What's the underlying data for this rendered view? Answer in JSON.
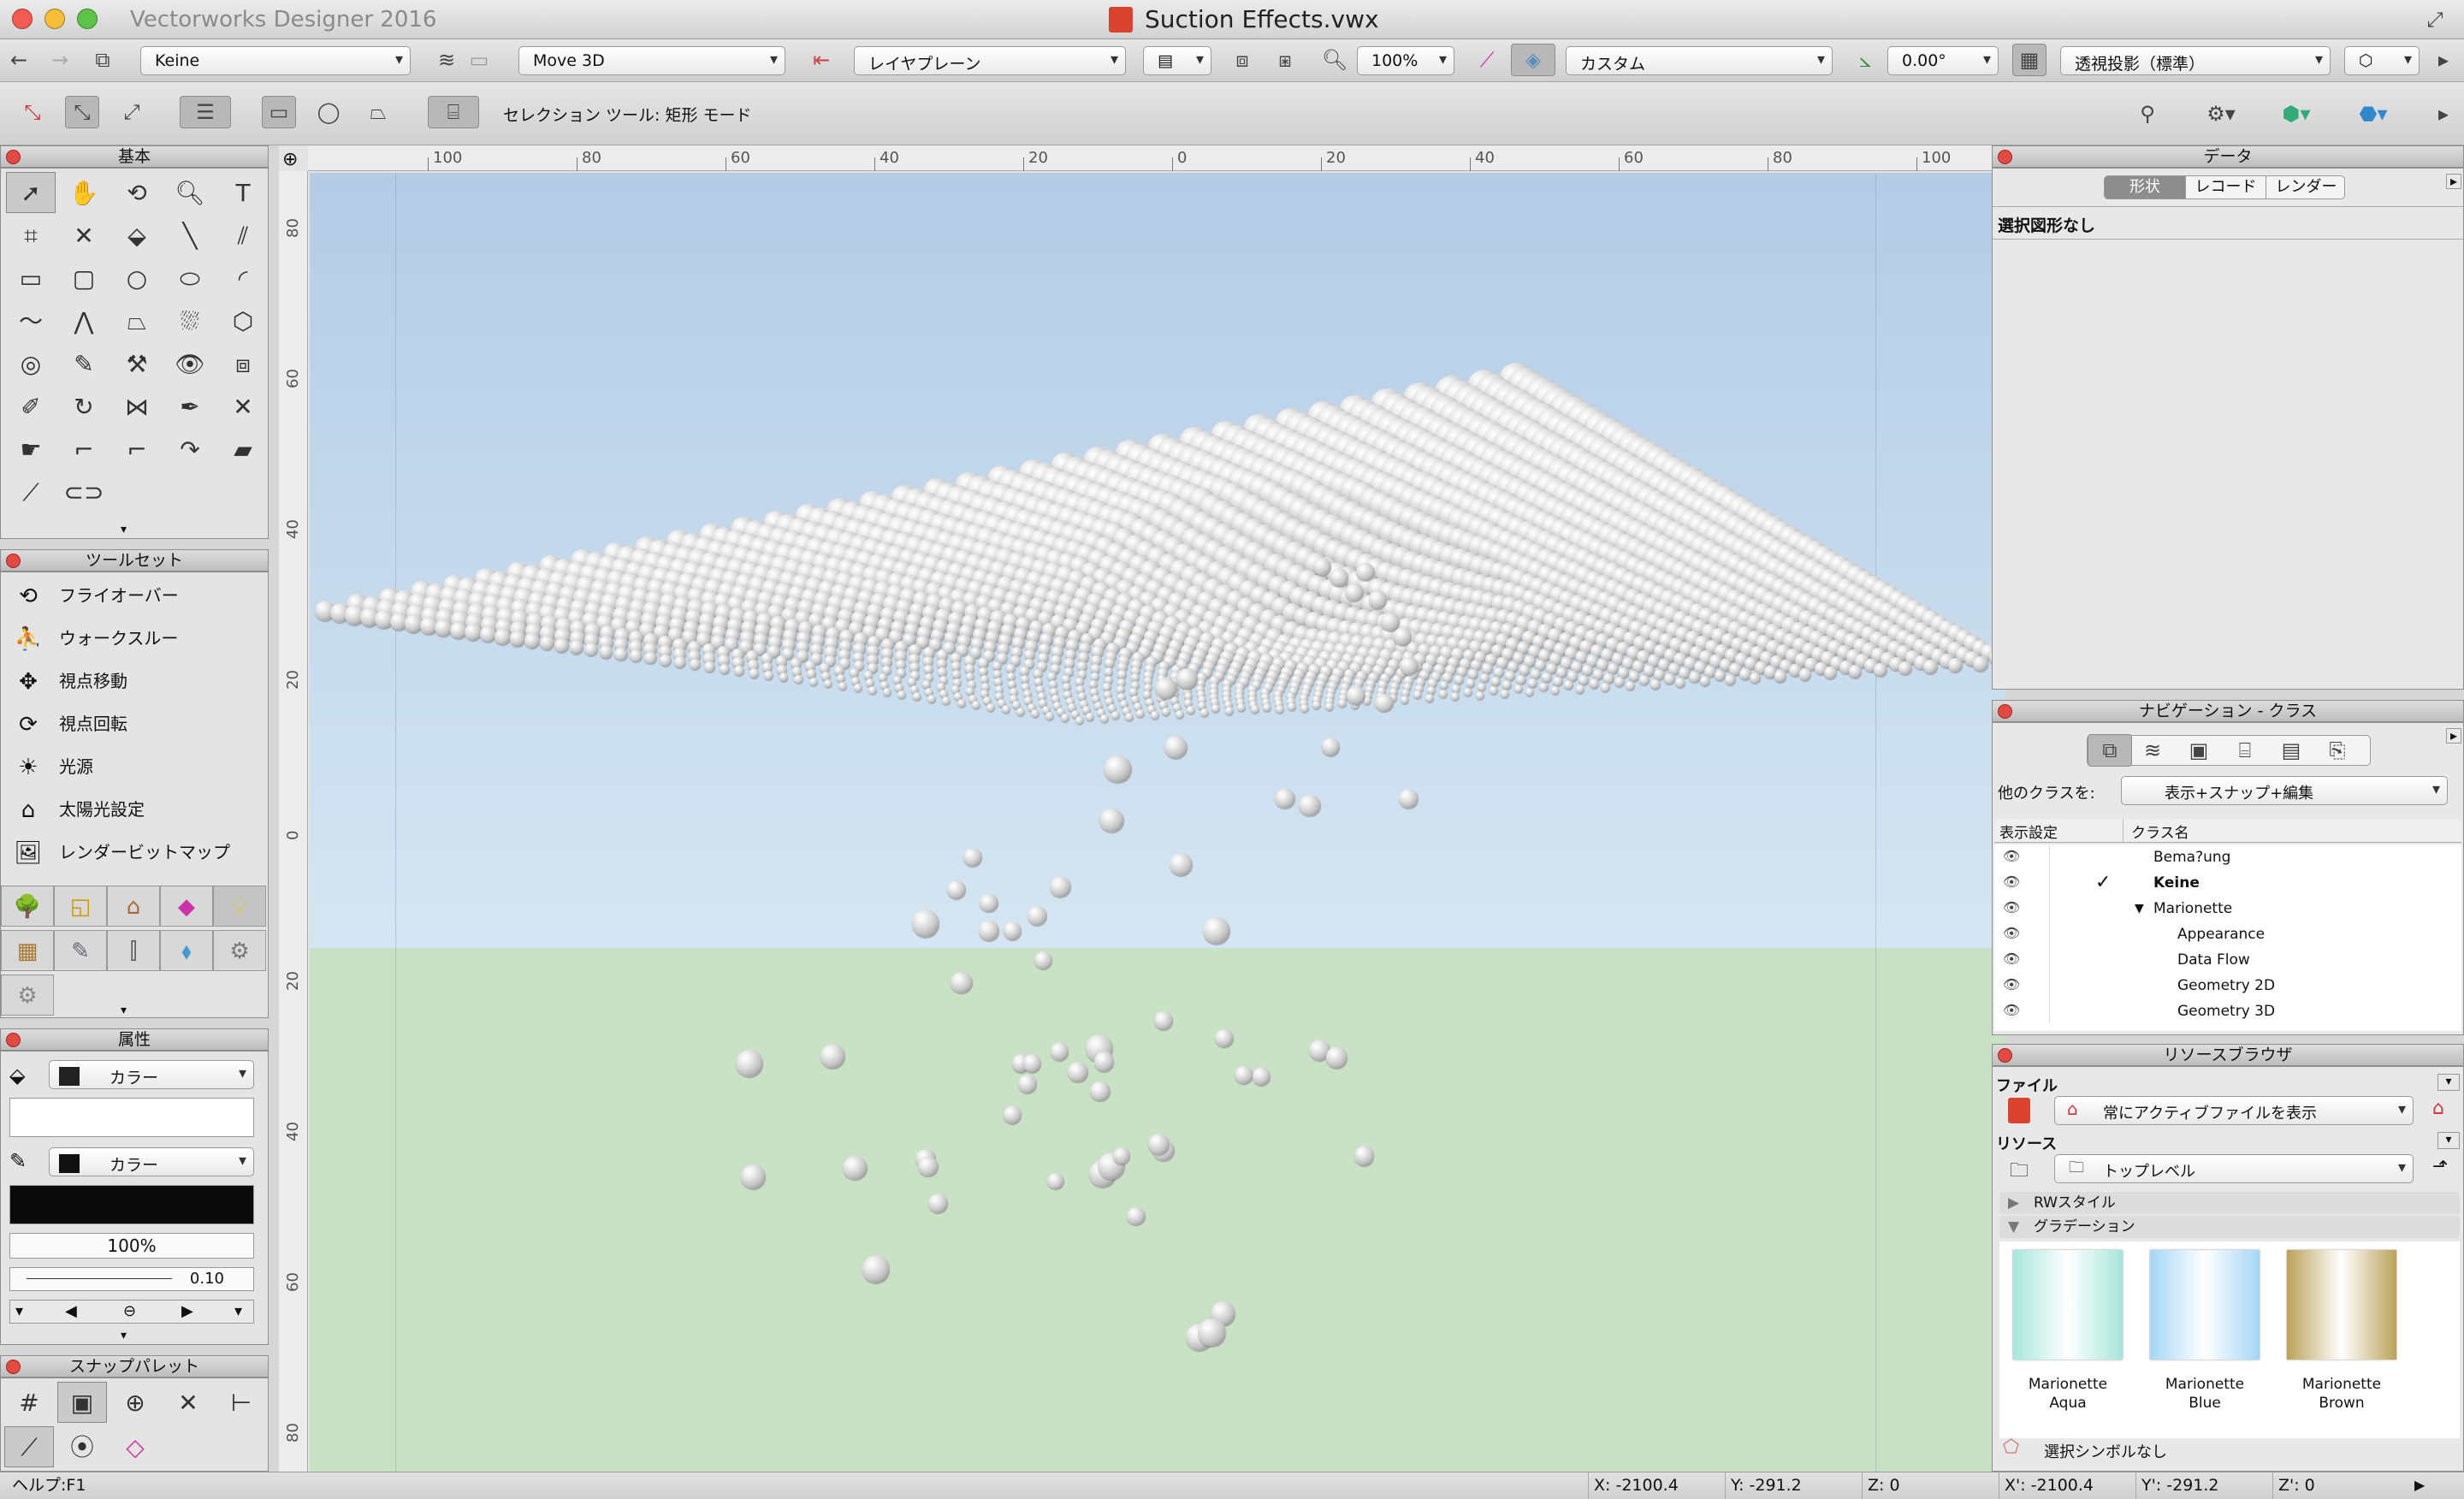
{
  "window": {
    "app_title": "Vectorworks Designer 2016",
    "doc_title": "Suction Effects.vwx"
  },
  "toolbar1": {
    "class_dropdown": "Keine",
    "layer_dropdown": "Move 3D",
    "plane_dropdown": "レイヤプレーン",
    "zoom_value": "100%",
    "view_dropdown": "カスタム",
    "angle_value": "0.00°",
    "projection_dropdown": "透視投影（標準）"
  },
  "toolbar2": {
    "mode_text": "セレクション ツール: 矩形 モード"
  },
  "palettes": {
    "basic": {
      "title": "基本"
    },
    "toolset": {
      "title": "ツールセット",
      "items": [
        "フライオーバー",
        "ウォークスルー",
        "視点移動",
        "視点回転",
        "光源",
        "太陽光設定",
        "レンダービットマップ"
      ]
    },
    "attributes": {
      "title": "属性",
      "fill_type": "カラー",
      "pen_type": "カラー",
      "opacity": "100%",
      "line_weight": "0.10"
    },
    "snap": {
      "title": "スナップパレット"
    }
  },
  "ruler": {
    "h_labels": [
      "100",
      "80",
      "60",
      "40",
      "20",
      "0",
      "20",
      "40",
      "60",
      "80",
      "100"
    ],
    "v_labels": [
      "80",
      "60",
      "40",
      "20",
      "0",
      "20",
      "40",
      "60",
      "80"
    ]
  },
  "data_palette": {
    "title": "データ",
    "tabs": [
      "形状",
      "レコード",
      "レンダー"
    ],
    "active_tab": "形状",
    "selection_text": "選択図形なし"
  },
  "nav_palette": {
    "title": "ナビゲーション - クラス",
    "other_classes_label": "他のクラスを:",
    "other_classes_value": "表示+スナップ+編集",
    "col_visibility": "表示設定",
    "col_class_name": "クラス名",
    "classes": [
      {
        "name": "Bema?ung",
        "active": false,
        "indent": 0
      },
      {
        "name": "Keine",
        "active": true,
        "indent": 0
      },
      {
        "name": "Marionette",
        "active": false,
        "indent": 0,
        "expanded": true
      },
      {
        "name": "Appearance",
        "active": false,
        "indent": 1
      },
      {
        "name": "Data Flow",
        "active": false,
        "indent": 1
      },
      {
        "name": "Geometry 2D",
        "active": false,
        "indent": 1
      },
      {
        "name": "Geometry 3D",
        "active": false,
        "indent": 1
      }
    ]
  },
  "resource_browser": {
    "title": "リソースブラウザ",
    "file_label": "ファイル",
    "file_value": "常にアクティブファイルを表示",
    "resource_label": "リソース",
    "resource_value": "トップレベル",
    "folders": [
      {
        "name": "RWスタイル",
        "expanded": false
      },
      {
        "name": "グラデーション",
        "expanded": true
      }
    ],
    "items": [
      {
        "name": "Marionette Aqua",
        "line1": "Marionette",
        "line2": "Aqua",
        "color": "#a6e6da"
      },
      {
        "name": "Marionette Blue",
        "line1": "Marionette",
        "line2": "Blue",
        "color": "#a4d6f6"
      },
      {
        "name": "Marionette Brown",
        "line1": "Marionette",
        "line2": "Brown",
        "color": "#bba35a"
      }
    ],
    "footer_text": "選択シンボルなし"
  },
  "status": {
    "help": "ヘルプ:F1",
    "x": "X: -2100.4",
    "y": "Y: -291.2",
    "z": "Z: 0",
    "x2": "X': -2100.4",
    "y2": "Y': -291.2",
    "z2": "Z': 0"
  },
  "colors": {
    "sky_top": "#b4cce6",
    "sky_bottom": "#d5e6f2",
    "ground": "#c9e1c4",
    "close_red": "#e24b42"
  }
}
